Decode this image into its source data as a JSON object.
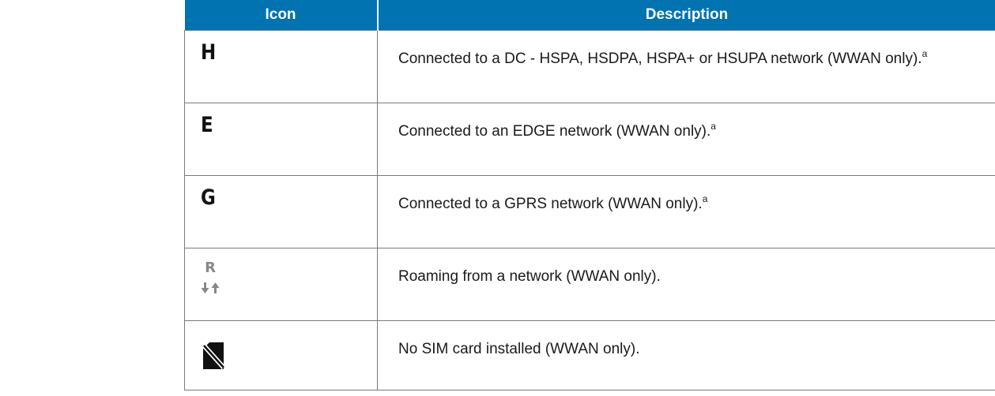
{
  "table": {
    "headers": {
      "icon": "Icon",
      "description": "Description"
    },
    "rows": [
      {
        "icon_name": "network-h-icon",
        "icon_glyph": "H",
        "description": "Connected to a DC - HSPA, HSDPA, HSPA+ or HSUPA network (WWAN only).",
        "footnote": "a"
      },
      {
        "icon_name": "network-e-icon",
        "icon_glyph": "E",
        "description": "Connected to an EDGE network (WWAN only).",
        "footnote": "a"
      },
      {
        "icon_name": "network-g-icon",
        "icon_glyph": "G",
        "description": "Connected to a GPRS network (WWAN only).",
        "footnote": "a"
      },
      {
        "icon_name": "roaming-icon",
        "icon_glyph": "R",
        "description": "Roaming from a network (WWAN only).",
        "footnote": ""
      },
      {
        "icon_name": "no-sim-icon",
        "icon_glyph": "",
        "description": "No SIM card installed (WWAN only).",
        "footnote": ""
      }
    ]
  },
  "colors": {
    "header_bg": "#0073b0",
    "header_text": "#ffffff",
    "border": "#7a7a7a",
    "roaming_glyph": "#888888"
  }
}
